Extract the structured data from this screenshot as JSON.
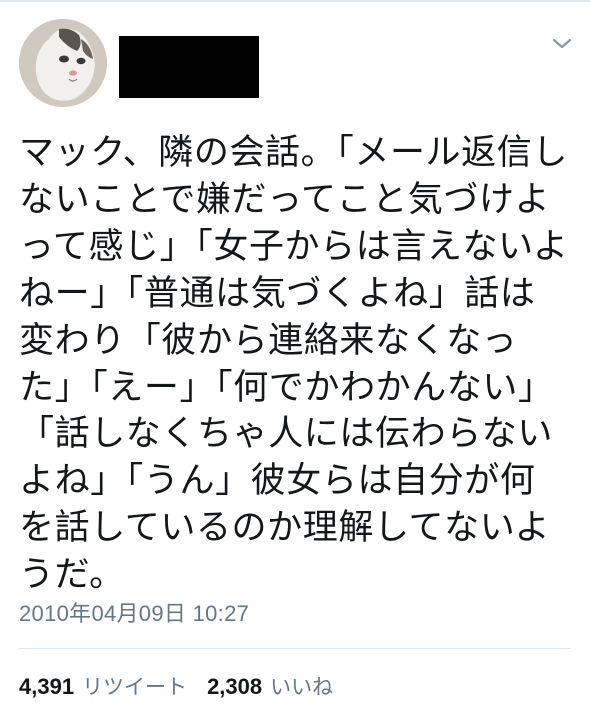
{
  "tweet": {
    "text": "マック、隣の会話。「メール返信しないことで嫌だってこと気づけよって感じ」「女子からは言えないよねー」「普通は気づくよね」話は変わり「彼から連絡来なくなった」「えー」「何でかわかんない」「話しなくちゃ人には伝わらないよね」「うん」彼女らは自分が何を話しているのか理解してないようだ。",
    "timestamp": "2010年04月09日 10:27"
  },
  "stats": {
    "retweets_count": "4,391",
    "retweets_label": "リツイート",
    "likes_count": "2,308",
    "likes_label": "いいね"
  },
  "icons": {
    "avatar": "cat-avatar",
    "menu": "chevron-down-icon"
  }
}
